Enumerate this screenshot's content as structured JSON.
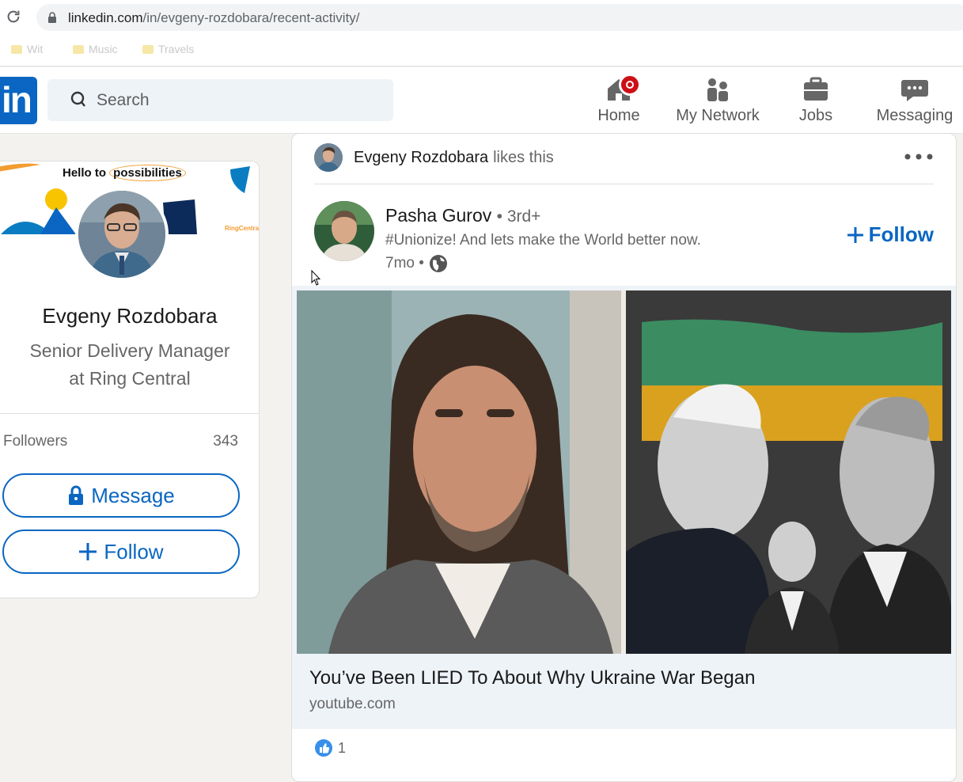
{
  "browser": {
    "url_host": "linkedin.com",
    "url_path": "/in/evgeny-rozdobara/recent-activity/",
    "bookmarks": [
      "Wit",
      "Music",
      "Travels"
    ]
  },
  "nav": {
    "logo": "in",
    "search_placeholder": "Search",
    "items": [
      {
        "label": "Home",
        "icon": "home-icon"
      },
      {
        "label": "My Network",
        "icon": "network-icon"
      },
      {
        "label": "Jobs",
        "icon": "jobs-icon"
      },
      {
        "label": "Messaging",
        "icon": "messaging-icon"
      }
    ]
  },
  "profile": {
    "cover_text_pre": "Hello to ",
    "cover_text_circled": "possibilities",
    "cover_brand": "RingCentral",
    "name": "Evgeny Rozdobara",
    "headline_line1": "Senior Delivery Manager",
    "headline_line2": "at Ring Central",
    "followers_label": "Followers",
    "followers_count": "343",
    "message_label": "Message",
    "follow_label": "Follow"
  },
  "post": {
    "liker_name": "Evgeny Rozdobara",
    "liker_suffix": "likes this",
    "author_name": "Pasha Gurov",
    "author_degree": "• 3rd+",
    "author_tagline": "#Unionize! And lets make the World better now.",
    "time": "7mo •",
    "follow_label": "Follow",
    "media_title": "You’ve Been LIED To About Why Ukraine War Began",
    "media_source": "youtube.com",
    "reaction_count": "1"
  },
  "colors": {
    "brand": "#0a66c2",
    "badge": "#cc1016"
  }
}
